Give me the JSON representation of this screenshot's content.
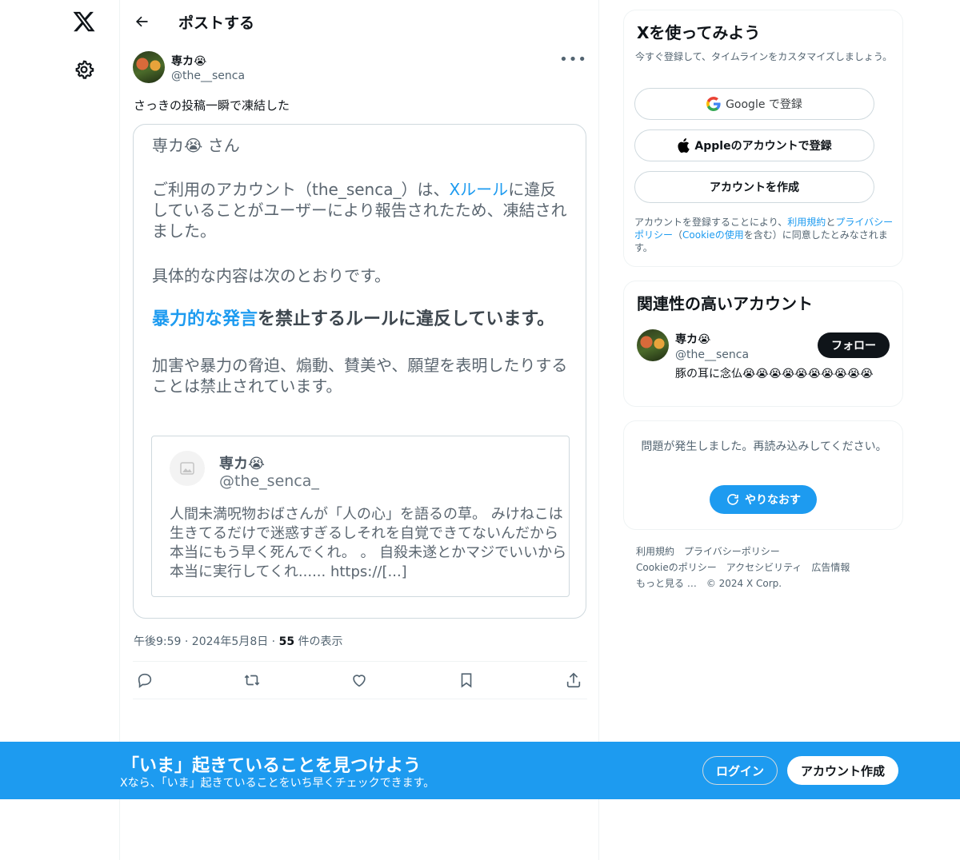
{
  "header": {
    "title": "ポストする"
  },
  "post": {
    "author_name": "専カ😭",
    "author_handle": "@the__senca",
    "text": "さっきの投稿一瞬で凍結した",
    "time": "午後9:59 · 2024年5月8日 · ",
    "views_count": "55",
    "views_label": " 件の表示"
  },
  "card": {
    "greeting": "専カ😭 さん",
    "p1_before": "ご利用のアカウント（the_senca_）は、",
    "p1_link": "Xルール",
    "p1_after": "に違反していることがユーザーにより報告されたため、凍結されました。",
    "p2": "具体的な内容は次のとおりです。",
    "rule_highlight": "暴力的な発言",
    "rule_rest": "を禁止するルールに違反しています。",
    "p3": "加害や暴力の脅迫、煽動、賛美や、願望を表明したりすることは禁止されています。",
    "quote": {
      "name": "専カ😭",
      "handle": "@the_senca_",
      "text": "人間未満呪物おばさんが「人の心」を語るの草。 みけねこは生きてるだけで迷惑すぎるしそれを自覚できてないんだから本当にもう早く死んでくれ。 。 自殺未遂とかマジでいいから本当に実行してくれ...... https://[...]"
    }
  },
  "signup": {
    "title": "Xを使ってみよう",
    "subtitle": "今すぐ登録して、タイムラインをカスタマイズしましょう。",
    "google_label": "Google で登録",
    "apple_label": "Appleのアカウントで登録",
    "create_label": "アカウントを作成",
    "legal_1": "アカウントを登録することにより、",
    "legal_terms": "利用規約",
    "legal_2": "と",
    "legal_privacy": "プライバシーポリシー",
    "legal_3": "（",
    "legal_cookie": "Cookieの使用",
    "legal_4": "を含む）に同意したとみなされます。"
  },
  "related": {
    "title": "関連性の高いアカウント",
    "name": "専カ😭",
    "handle": "@the__senca",
    "bio": "豚の耳に念仏😭😭😭😭😭😭😭😭😭😭",
    "follow_label": "フォロー"
  },
  "error": {
    "text": "問題が発生しました。再読み込みしてください。",
    "retry_label": "やりなおす"
  },
  "footer": {
    "links": [
      "利用規約",
      "プライバシーポリシー",
      "Cookieのポリシー",
      "アクセシビリティ",
      "広告情報",
      "もっと見る …",
      "© 2024 X Corp."
    ]
  },
  "banner": {
    "title": "「いま」起きていることを見つけよう",
    "subtitle": "Xなら、「いま」起きていることをいち早くチェックできます。",
    "login_label": "ログイン",
    "create_label": "アカウント作成"
  },
  "colors": {
    "accent": "#1d9bf0",
    "text": "#0f1419",
    "muted": "#536471"
  }
}
